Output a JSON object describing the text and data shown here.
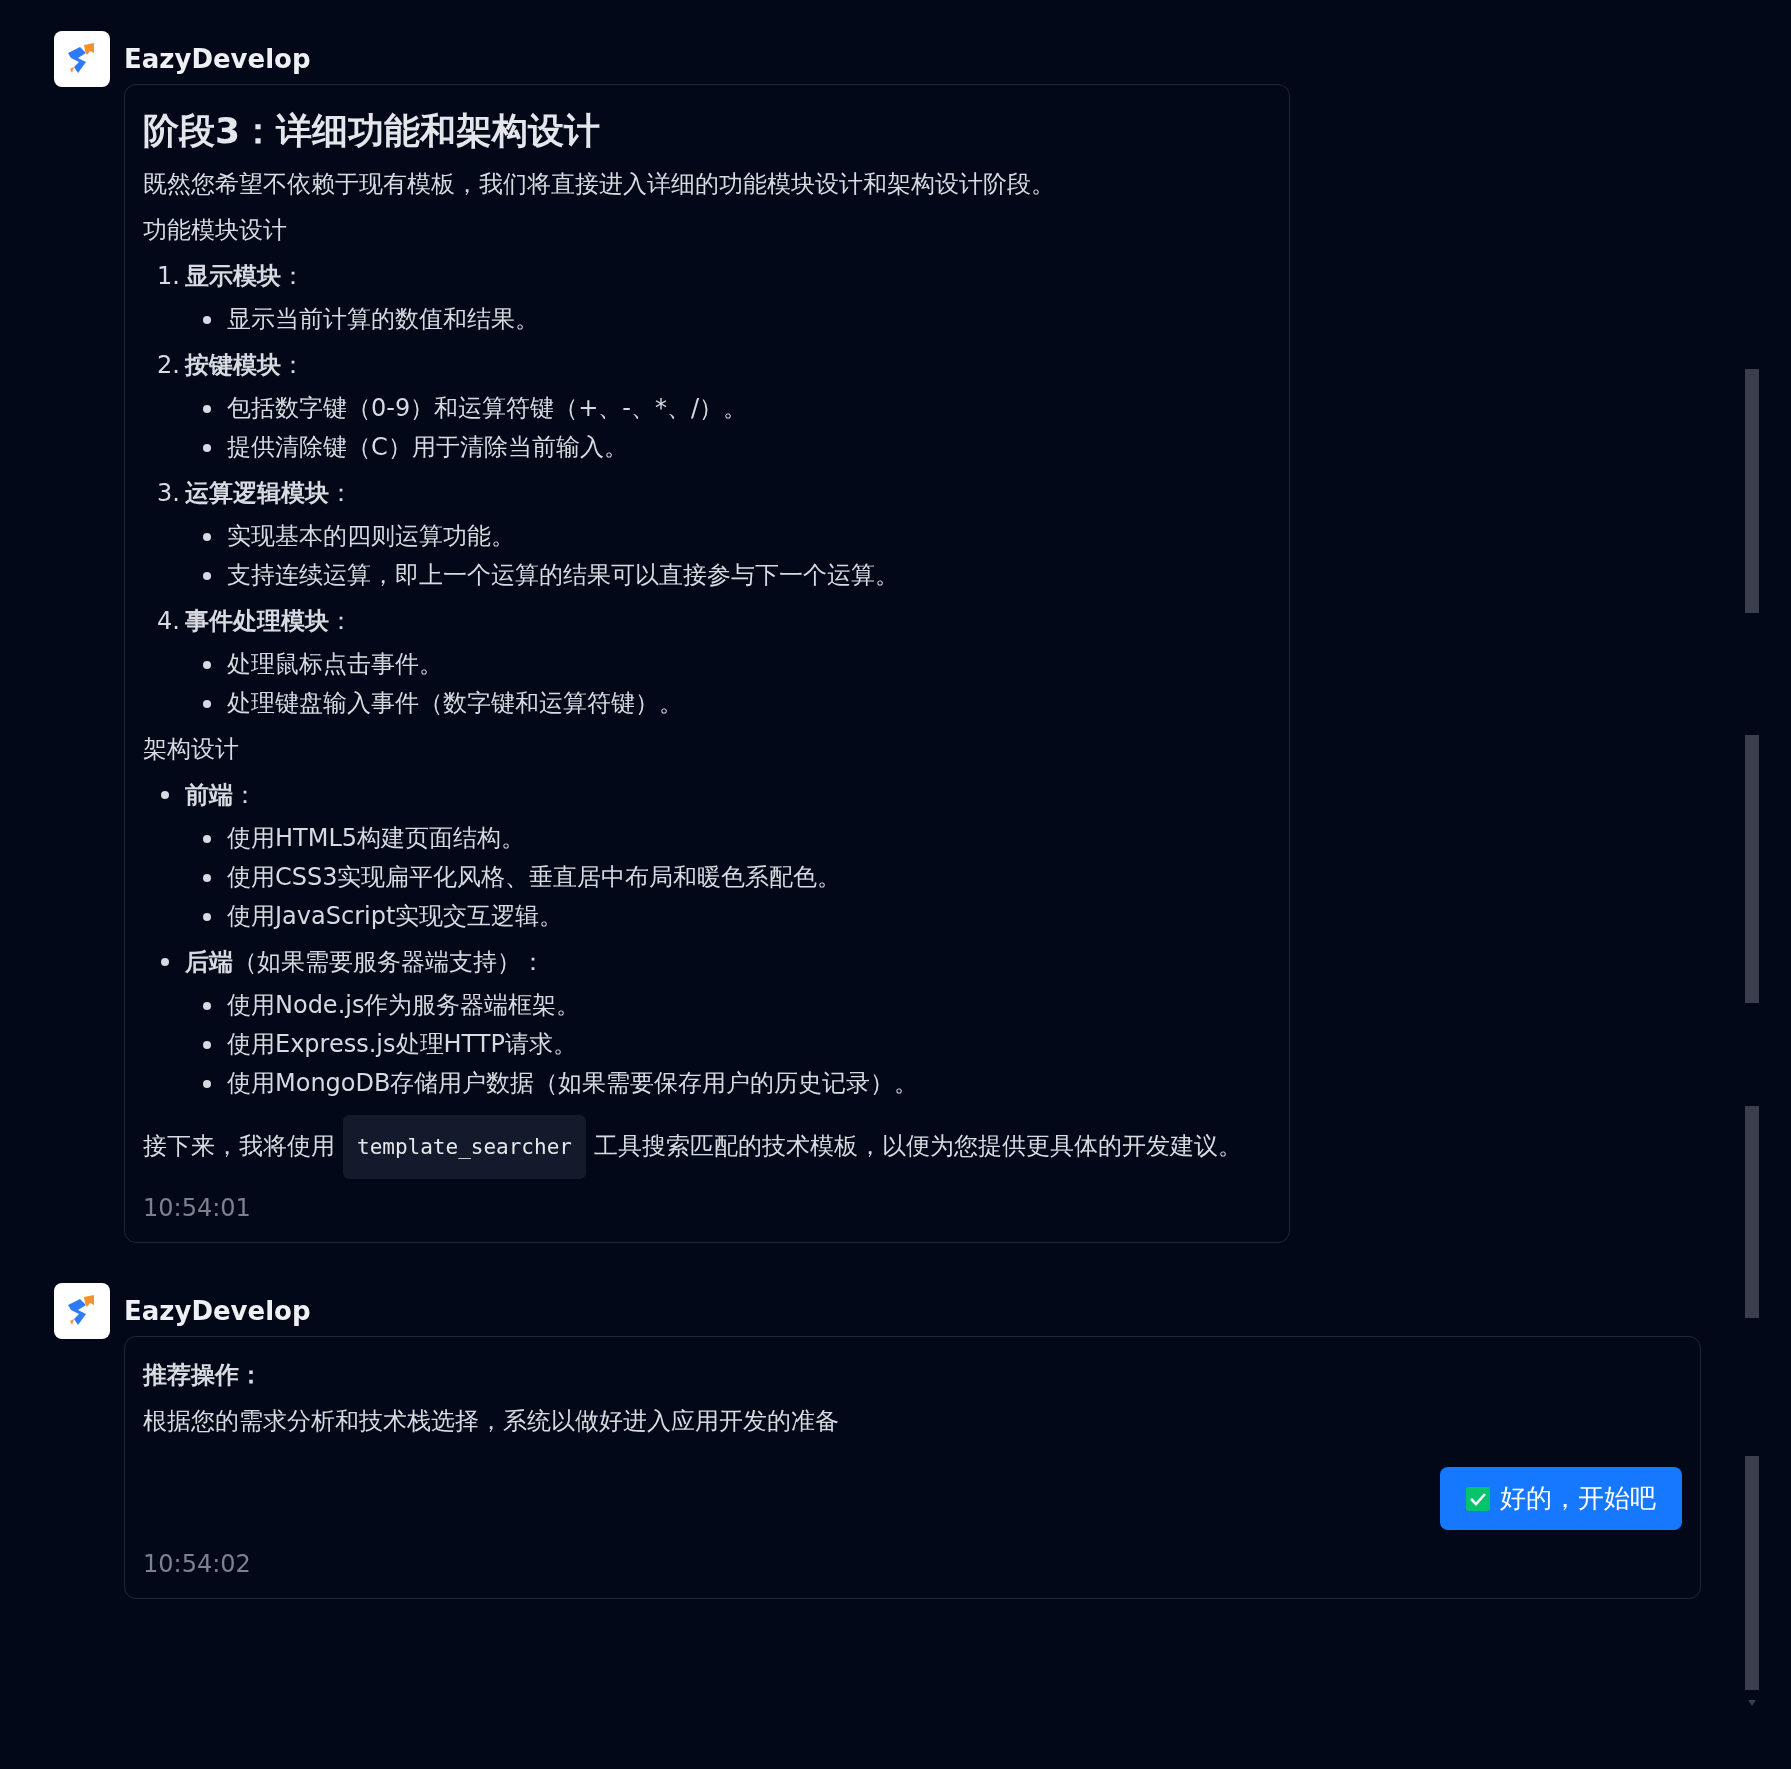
{
  "messages": [
    {
      "sender": "EazyDevelop",
      "kind": "plan",
      "title": "阶段3：详细功能和架构设计",
      "intro": "既然您希望不依赖于现有模板，我们将直接进入详细的功能模块设计和架构设计阶段。",
      "sections": [
        {
          "heading": "功能模块设计",
          "kind": "ordered",
          "items": [
            {
              "marker": "1.",
              "label": "**显示模块**：",
              "children": [
                "显示当前计算的数值和结果。"
              ]
            },
            {
              "marker": "2.",
              "label": "**按键模块**：",
              "children": [
                "包括数字键（0-9）和运算符键（+、-、*、/）。",
                "提供清除键（C）用于清除当前输入。"
              ]
            },
            {
              "marker": "3.",
              "label": "**运算逻辑模块**：",
              "children": [
                "实现基本的四则运算功能。",
                "支持连续运算，即上一个运算的结果可以直接参与下一个运算。"
              ]
            },
            {
              "marker": "4.",
              "label": "**事件处理模块**：",
              "children": [
                "处理鼠标点击事件。",
                "处理键盘输入事件（数字键和运算符键）。"
              ]
            }
          ]
        },
        {
          "heading": "架构设计",
          "kind": "bulleted",
          "items": [
            {
              "label": "**前端**：",
              "children": [
                "使用HTML5构建页面结构。",
                "使用CSS3实现扁平化风格、垂直居中布局和暖色系配色。",
                "使用JavaScript实现交互逻辑。"
              ]
            },
            {
              "label": "**后端**（如果需要服务器端支持）：",
              "children": [
                "使用Node.js作为服务器端框架。",
                "使用Express.js处理HTTP请求。",
                "使用MongoDB存储用户数据（如果需要保存用户的历史记录）。"
              ]
            }
          ]
        }
      ],
      "closing": {
        "before": "接下来，我将使用",
        "code": "template_searcher",
        "after": "工具搜索匹配的技术模板，以便为您提供更具体的开发建议。"
      },
      "time": "10:54:01"
    },
    {
      "sender": "EazyDevelop",
      "kind": "action",
      "heading": "推荐操作：",
      "text": "根据您的需求分析和技术栈选择，系统以做好进入应用开发的准备",
      "button": "好的，开始吧",
      "time": "10:54:02"
    }
  ]
}
